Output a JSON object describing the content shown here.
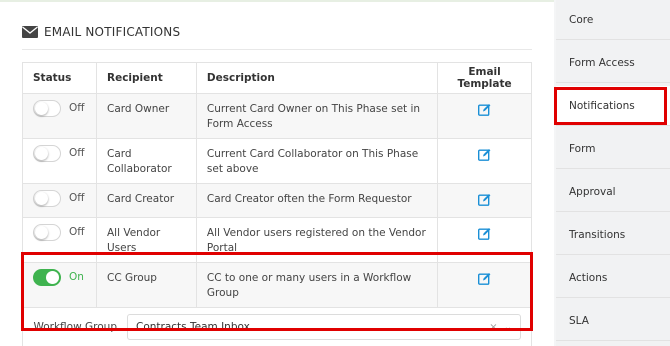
{
  "section": {
    "icon": "envelope-icon",
    "title": "EMAIL NOTIFICATIONS"
  },
  "table": {
    "headers": {
      "status": "Status",
      "recipient": "Recipient",
      "description": "Description",
      "template": "Email Template"
    },
    "rows": [
      {
        "status": "Off",
        "enabled": false,
        "recipient": "Card Owner",
        "description": "Current Card Owner on This Phase set in Form Access",
        "template_icon": "edit-icon"
      },
      {
        "status": "Off",
        "enabled": false,
        "recipient": "Card Collaborator",
        "description": "Current Card Collaborator on This Phase set above",
        "template_icon": "edit-icon"
      },
      {
        "status": "Off",
        "enabled": false,
        "recipient": "Card Creator",
        "description": "Card Creator often the Form Requestor",
        "template_icon": "edit-icon"
      },
      {
        "status": "Off",
        "enabled": false,
        "recipient": "All Vendor Users",
        "description": "All Vendor users registered on the Vendor Portal",
        "template_icon": "edit-icon"
      },
      {
        "status": "On",
        "enabled": true,
        "recipient": "CC Group",
        "description": "CC to one or many users in a Workflow Group",
        "template_icon": "edit-icon"
      }
    ]
  },
  "workflow_group": {
    "label": "Workflow Group",
    "value": "Contracts Team Inbox",
    "clear_icon": "×",
    "dropdown_icon": "⌄"
  },
  "sidebar": {
    "items": [
      {
        "label": "Core"
      },
      {
        "label": "Form Access"
      },
      {
        "label": "Notifications",
        "active": true
      },
      {
        "label": "Form"
      },
      {
        "label": "Approval"
      },
      {
        "label": "Transitions"
      },
      {
        "label": "Actions"
      },
      {
        "label": "SLA"
      }
    ]
  },
  "colors": {
    "toggle_on": "#3fb34f",
    "edit_icon": "#1a8fd6",
    "highlight": "#e00000"
  }
}
